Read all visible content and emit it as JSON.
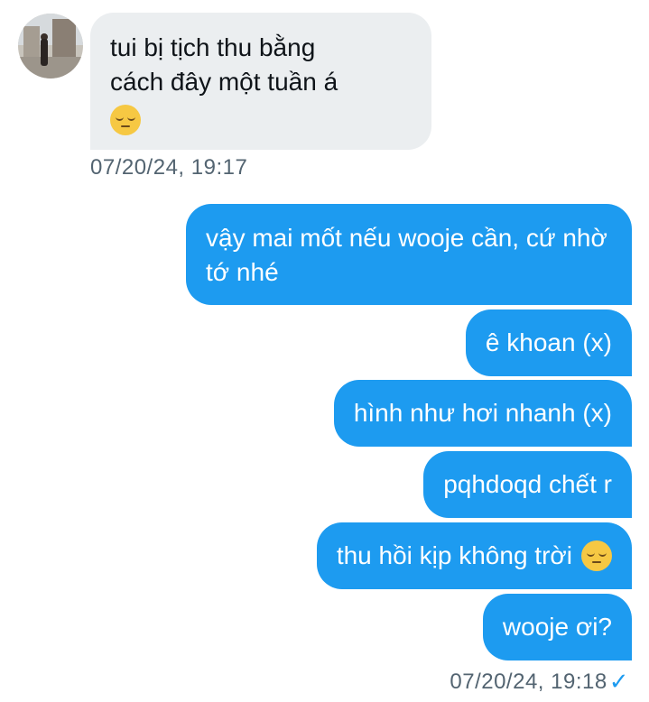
{
  "incoming": {
    "avatar_icon": "user-avatar",
    "message_line1": "tui bị tịch thu bằng",
    "message_line2": "cách đây một tuần á",
    "timestamp": "07/20/24, 19:17"
  },
  "outgoing": {
    "messages": [
      "vậy mai mốt nếu wooje cần, cứ nhờ tớ nhé",
      "ê khoan (x)",
      "hình như hơi nhanh (x)",
      "pqhdoqd chết r",
      "thu hồi kịp không trời",
      "wooje ơi?"
    ],
    "timestamp": "07/20/24, 19:18",
    "status_icon": "sent-check-icon",
    "bubble_color": "#1d9bf0"
  },
  "colors": {
    "incoming_bubble": "#ebeef0",
    "timestamp_text": "#536471"
  }
}
